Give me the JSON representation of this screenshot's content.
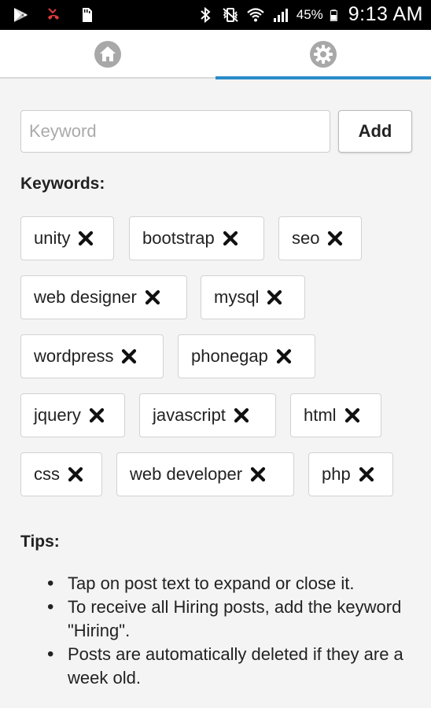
{
  "status_bar": {
    "battery": "45%",
    "time": "9:13 AM"
  },
  "tabs": [
    {
      "name": "home",
      "icon": "home-icon",
      "selected": false
    },
    {
      "name": "settings",
      "icon": "gear-icon",
      "selected": true
    }
  ],
  "colors": {
    "accent": "#2a8bc9",
    "background": "#f4f4f4"
  },
  "keyword_input": {
    "value": "",
    "placeholder": "Keyword"
  },
  "add_button": {
    "label": "Add"
  },
  "keywords_heading": "Keywords:",
  "keywords": [
    "unity",
    "bootstrap",
    "seo",
    "web designer",
    "mysql",
    "wordpress",
    "phonegap",
    "jquery",
    "javascript",
    "html",
    "css",
    "web developer",
    "php"
  ],
  "tips_heading": "Tips:",
  "tips": [
    "Tap on post text to expand or close it.",
    "To receive all Hiring posts, add the keyword \"Hiring\".",
    "Posts are automatically deleted if they are a week old."
  ]
}
